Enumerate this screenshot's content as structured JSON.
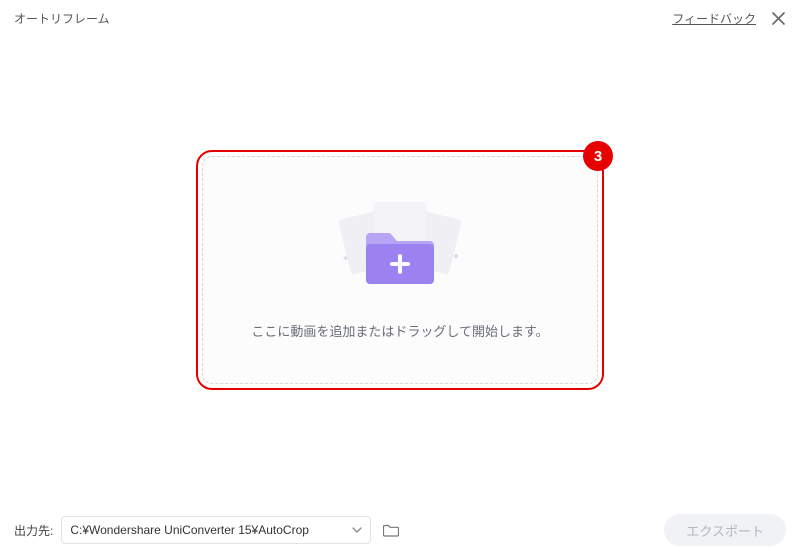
{
  "header": {
    "title": "オートリフレーム",
    "feedback": "フィードバック"
  },
  "dropzone": {
    "text": "ここに動画を追加またはドラッグして開始します。"
  },
  "annotation": {
    "step": "3"
  },
  "footer": {
    "output_label": "出力先:",
    "path": "C:¥Wondershare UniConverter 15¥AutoCrop",
    "export_label": "エクスポート"
  }
}
